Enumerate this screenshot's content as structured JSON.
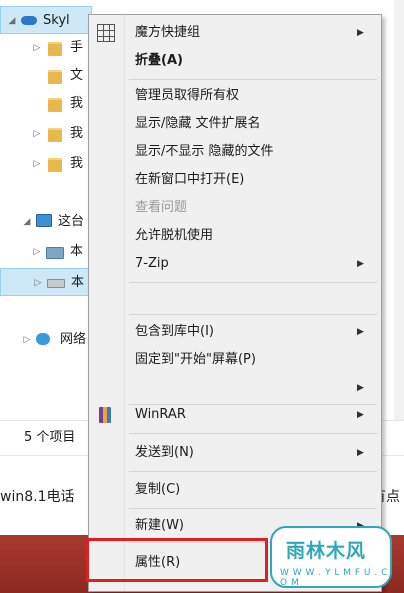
{
  "explorer": {
    "tree": [
      {
        "label": "Skyl",
        "arrow": "◢",
        "icon": "cloud-icon",
        "selected": true
      },
      {
        "label": "手",
        "arrow": "▷",
        "icon": "folder-icon"
      },
      {
        "label": "文",
        "arrow": "",
        "icon": "folder-icon"
      },
      {
        "label": "我",
        "arrow": "",
        "icon": "folder-icon"
      },
      {
        "label": "我",
        "arrow": "▷",
        "icon": "folder-icon"
      },
      {
        "label": "我",
        "arrow": "▷",
        "icon": "folder-icon"
      },
      {
        "label": "这台",
        "arrow": "◢",
        "icon": "computer-icon"
      },
      {
        "label": "本",
        "arrow": "▷",
        "icon": "drive-icon"
      },
      {
        "label": "本",
        "arrow": "▷",
        "icon": "disk-icon",
        "selected": true
      },
      {
        "label": "网络",
        "arrow": "▷",
        "icon": "network-icon"
      }
    ],
    "status": "5 个项目"
  },
  "article": {
    "left_text": "win8.1电话",
    "right_text": "有点"
  },
  "context_menu": {
    "items": [
      {
        "label": "魔方快捷组",
        "icon": "grid-icon",
        "submenu": true
      },
      {
        "label": "折叠(A)",
        "bold": true
      },
      {
        "label": "管理员取得所有权"
      },
      {
        "label": "显示/隐藏 文件扩展名"
      },
      {
        "label": "显示/不显示 隐藏的文件"
      },
      {
        "label": "在新窗口中打开(E)"
      },
      {
        "label": "查看问题",
        "disabled": true
      },
      {
        "label": "允许脱机使用"
      },
      {
        "label": "7-Zip",
        "submenu": true
      },
      {
        "label": "包含到库中(I)",
        "submenu": true
      },
      {
        "label": "固定到\"开始\"屏幕(P)"
      },
      {
        "label": "WinRAR",
        "icon": "winrar-icon",
        "submenu": true
      },
      {
        "label": "发送到(N)",
        "submenu": true
      },
      {
        "label": "复制(C)"
      },
      {
        "label": "新建(W)",
        "submenu": true
      },
      {
        "label": "属性(R)",
        "highlighted": true
      }
    ],
    "submenu_glyph": "▶",
    "highlight_color": "#e02020"
  },
  "watermark": {
    "main": "雨林木风",
    "url": "W W W . Y L M F U . C O M"
  }
}
